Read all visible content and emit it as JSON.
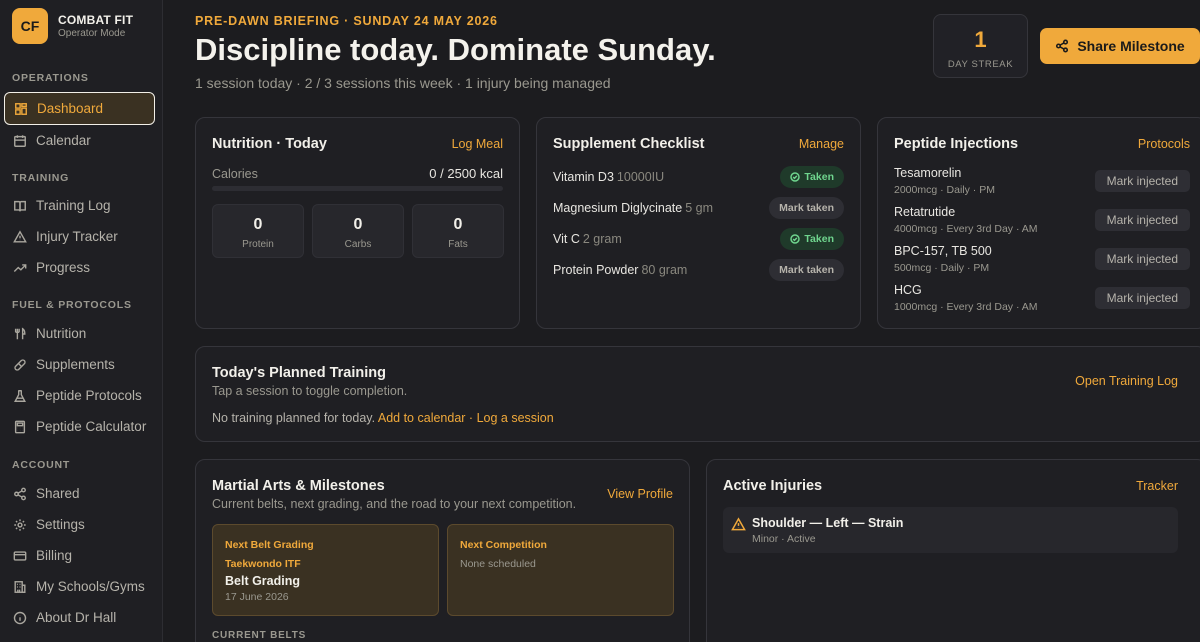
{
  "brand": {
    "logo": "CF",
    "name": "COMBAT FIT",
    "subtitle": "Operator Mode"
  },
  "sidebar": {
    "sections": [
      {
        "title": "OPERATIONS",
        "items": [
          {
            "label": "Dashboard",
            "icon": "dashboard-icon",
            "active": true
          },
          {
            "label": "Calendar",
            "icon": "calendar-icon"
          }
        ]
      },
      {
        "title": "TRAINING",
        "items": [
          {
            "label": "Training Log",
            "icon": "book-icon"
          },
          {
            "label": "Injury Tracker",
            "icon": "warning-icon"
          },
          {
            "label": "Progress",
            "icon": "trending-up-icon"
          }
        ]
      },
      {
        "title": "FUEL & PROTOCOLS",
        "items": [
          {
            "label": "Nutrition",
            "icon": "utensils-icon"
          },
          {
            "label": "Supplements",
            "icon": "pill-icon"
          },
          {
            "label": "Peptide Protocols",
            "icon": "flask-icon"
          },
          {
            "label": "Peptide Calculator",
            "icon": "calculator-icon"
          }
        ]
      },
      {
        "title": "ACCOUNT",
        "items": [
          {
            "label": "Shared",
            "icon": "share-icon"
          },
          {
            "label": "Settings",
            "icon": "gear-icon"
          },
          {
            "label": "Billing",
            "icon": "credit-card-icon"
          },
          {
            "label": "My Schools/Gyms",
            "icon": "building-icon"
          },
          {
            "label": "About Dr Hall",
            "icon": "info-icon"
          }
        ]
      }
    ]
  },
  "header": {
    "eyebrow": "PRE-DAWN BRIEFING · SUNDAY 24 MAY 2026",
    "title": "Discipline today. Dominate Sunday.",
    "subtitle": "1 session today · 2 / 3 sessions this week · 1 injury being managed",
    "streak_value": "1",
    "streak_label": "DAY STREAK",
    "share_label": "Share Milestone"
  },
  "nutrition": {
    "title": "Nutrition · Today",
    "action": "Log Meal",
    "calories_label": "Calories",
    "calories_value": "0 / 2500 kcal",
    "calories_progress": 0,
    "macros": [
      {
        "value": "0",
        "label": "Protein"
      },
      {
        "value": "0",
        "label": "Carbs"
      },
      {
        "value": "0",
        "label": "Fats"
      }
    ]
  },
  "supplements": {
    "title": "Supplement Checklist",
    "action": "Manage",
    "items": [
      {
        "name": "Vitamin D3",
        "qty": "10000IU",
        "status": "Taken",
        "taken": true
      },
      {
        "name": "Magnesium Diglycinate",
        "qty": "5 gm",
        "status": "Mark taken",
        "taken": false
      },
      {
        "name": "Vit C",
        "qty": "2 gram",
        "status": "Taken",
        "taken": true
      },
      {
        "name": "Protein Powder",
        "qty": "80 gram",
        "status": "Mark taken",
        "taken": false
      }
    ]
  },
  "peptides": {
    "title": "Peptide Injections",
    "action": "Protocols",
    "items": [
      {
        "name": "Tesamorelin",
        "detail": "2000mcg · Daily · PM",
        "button": "Mark injected"
      },
      {
        "name": "Retatrutide",
        "detail": "4000mcg · Every 3rd Day · AM",
        "button": "Mark injected"
      },
      {
        "name": "BPC-157, TB 500",
        "detail": "500mcg · Daily · PM",
        "button": "Mark injected"
      },
      {
        "name": "HCG",
        "detail": "1000mcg · Every 3rd Day · AM",
        "button": "Mark injected"
      }
    ]
  },
  "training": {
    "title": "Today's Planned Training",
    "subtitle": "Tap a session to toggle completion.",
    "action": "Open Training Log",
    "empty_text": "No training planned for today.",
    "add_link": "Add to calendar",
    "separator": "·",
    "log_link": "Log a session"
  },
  "martial": {
    "title": "Martial Arts & Milestones",
    "subtitle": "Current belts, next grading, and the road to your next competition.",
    "action": "View Profile",
    "grading": {
      "heading": "Next Belt Grading",
      "style": "Taekwondo ITF",
      "event": "Belt Grading",
      "date": "17 June 2026"
    },
    "competition": {
      "heading": "Next Competition",
      "value": "None scheduled"
    },
    "belts_heading": "CURRENT BELTS"
  },
  "injuries": {
    "title": "Active Injuries",
    "action": "Tracker",
    "items": [
      {
        "name": "Shoulder — Left — Strain",
        "detail": "Minor · Active"
      }
    ]
  },
  "colors": {
    "accent": "#f0a93b",
    "background": "#1c1c1f",
    "card": "#1f1f23",
    "taken_green": "#6fd58e"
  }
}
